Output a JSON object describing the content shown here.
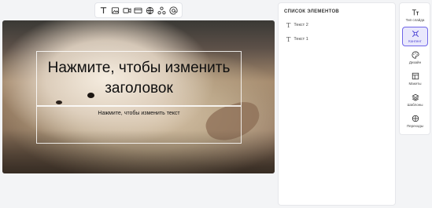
{
  "toolbar": {
    "tools": [
      {
        "name": "text-tool",
        "icon": "text-icon"
      },
      {
        "name": "image-tool",
        "icon": "image-icon"
      },
      {
        "name": "video-tool",
        "icon": "video-icon"
      },
      {
        "name": "card-tool",
        "icon": "card-icon"
      },
      {
        "name": "globe-tool",
        "icon": "globe-icon"
      },
      {
        "name": "shapes-tool",
        "icon": "shapes-icon"
      },
      {
        "name": "mention-tool",
        "icon": "at-icon"
      }
    ]
  },
  "slide": {
    "title": "Нажмите, чтобы изменить заголовок",
    "body": "Нажмите, чтобы изменить текст"
  },
  "elements_panel": {
    "title": "СПИСОК ЭЛЕМЕНТОВ",
    "items": [
      {
        "label": "Текст 2",
        "icon": "text-icon"
      },
      {
        "label": "Текст 1",
        "icon": "text-icon"
      }
    ]
  },
  "rail": {
    "items": [
      {
        "label": "Тип слайда",
        "icon": "slide-type-icon",
        "active": false
      },
      {
        "label": "Контент",
        "icon": "content-icon",
        "active": true
      },
      {
        "label": "Дизайн",
        "icon": "palette-icon",
        "active": false
      },
      {
        "label": "Макеты",
        "icon": "layout-icon",
        "active": false
      },
      {
        "label": "Шаблоны",
        "icon": "layers-icon",
        "active": false
      },
      {
        "label": "Переходы",
        "icon": "transition-icon",
        "active": false
      }
    ]
  },
  "colors": {
    "accent": "#6f66e8",
    "accent_bg": "#e9e8fc",
    "background": "#f3f4f6"
  }
}
